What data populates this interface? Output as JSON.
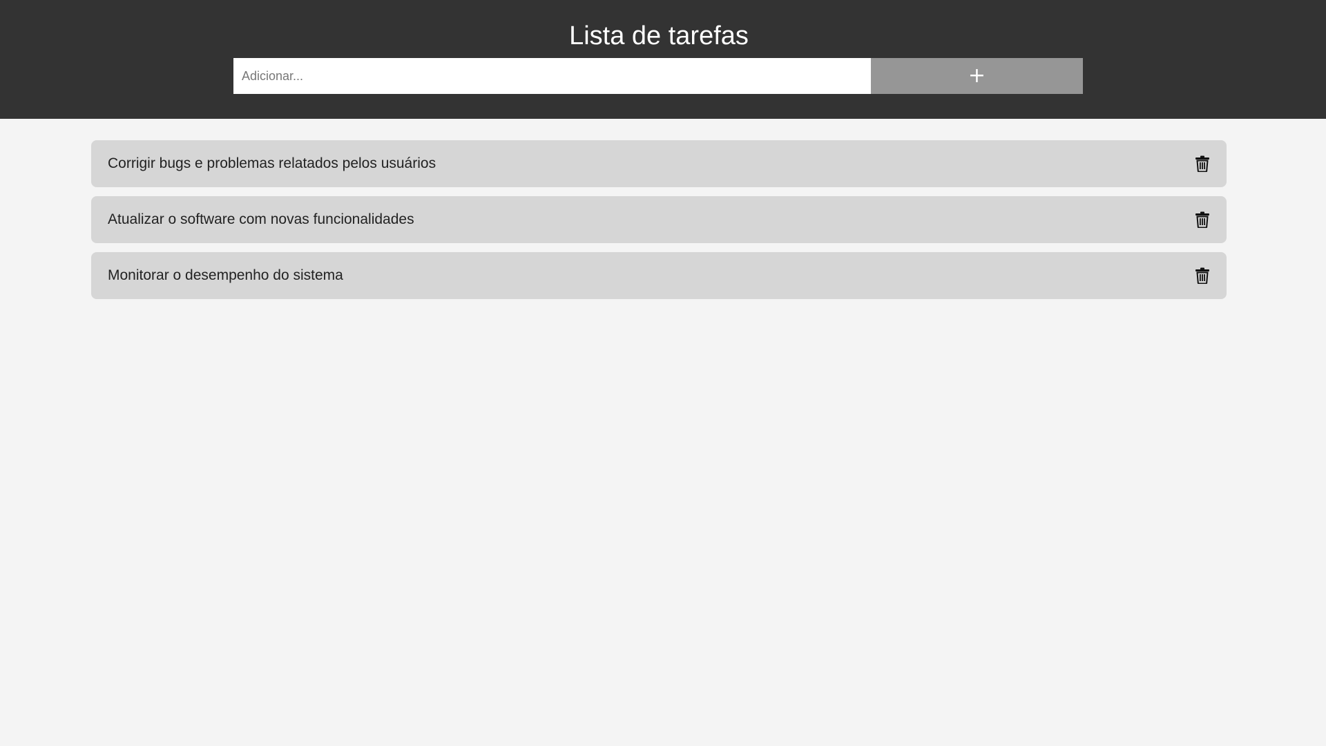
{
  "header": {
    "title": "Lista de tarefas",
    "input_placeholder": "Adicionar...",
    "input_value": "",
    "add_button_label": "+"
  },
  "tasks": [
    {
      "text": "Corrigir bugs e problemas relatados pelos usuários",
      "delete_icon": "trash-icon"
    },
    {
      "text": "Atualizar o software com novas funcionalidades",
      "delete_icon": "trash-icon"
    },
    {
      "text": "Monitorar o desempenho do sistema",
      "delete_icon": "trash-icon"
    }
  ],
  "colors": {
    "header_bg": "#333333",
    "page_bg": "#f4f4f4",
    "task_bg": "#d6d6d6",
    "add_button_bg": "#969696"
  }
}
